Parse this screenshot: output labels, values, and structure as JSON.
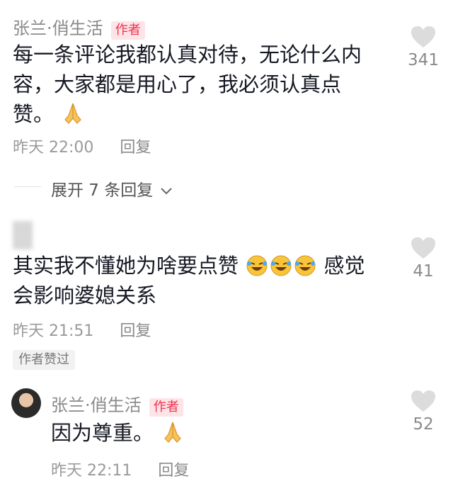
{
  "comments": [
    {
      "author": "张兰·俏生活",
      "badge": "作者",
      "text_lines": [
        "每一条评论我都认真对待，无论什么内",
        "容，大家都是用心了，我必须认真点",
        "赞。"
      ],
      "time": "昨天 22:00",
      "reply_label": "回复",
      "likes": "341"
    },
    {
      "text_line1": "其实我不懂她为啥要点赞",
      "text_line1_end": "感觉",
      "text_line2": "会影响婆媳关系",
      "time": "昨天 21:51",
      "reply_label": "回复",
      "likes": "41",
      "liked_tag": "作者赞过"
    }
  ],
  "expand_replies": {
    "label": "展开 7 条回复"
  },
  "reply": {
    "author": "张兰·俏生活",
    "badge": "作者",
    "text": "因为尊重。",
    "time": "昨天 22:11",
    "reply_label": "回复",
    "likes": "52"
  },
  "colors": {
    "badge_bg": "#fde4e7",
    "badge_text": "#f0324f",
    "heart": "#dcdcdc"
  }
}
